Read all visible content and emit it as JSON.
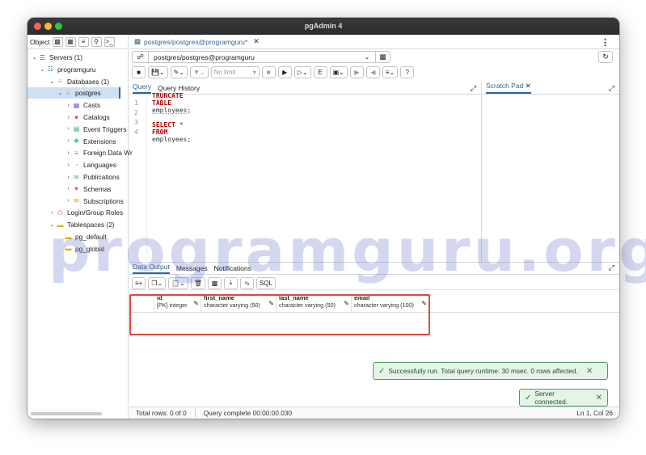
{
  "window": {
    "title": "pgAdmin 4"
  },
  "object_explorer": {
    "label": "Object",
    "tree": [
      {
        "label": "Servers (1)",
        "chev": "v",
        "icon": "server-group-icon",
        "color": "#5b6b7b"
      },
      {
        "label": "programguru",
        "chev": "v",
        "icon": "server-icon",
        "color": "#326690"
      },
      {
        "label": "Databases (1)",
        "chev": "v",
        "icon": "databases-icon",
        "color": "#d4a017"
      },
      {
        "label": "postgres",
        "chev": "v",
        "icon": "database-icon",
        "color": "#d4a017"
      },
      {
        "label": "Casts",
        "chev": ">",
        "icon": "casts-icon",
        "color": "#7a5bc7"
      },
      {
        "label": "Catalogs",
        "chev": ">",
        "icon": "catalogs-icon",
        "color": "#c44"
      },
      {
        "label": "Event Triggers",
        "chev": ">",
        "icon": "event-triggers-icon",
        "color": "#2a8"
      },
      {
        "label": "Extensions",
        "chev": ">",
        "icon": "extensions-icon",
        "color": "#2a7"
      },
      {
        "label": "Foreign Data Wr",
        "chev": ">",
        "icon": "foreign-data-icon",
        "color": "#a73"
      },
      {
        "label": "Languages",
        "chev": ">",
        "icon": "languages-icon",
        "color": "#e9b000"
      },
      {
        "label": "Publications",
        "chev": ">",
        "icon": "publications-icon",
        "color": "#5a7"
      },
      {
        "label": "Schemas",
        "chev": ">",
        "icon": "schemas-icon",
        "color": "#c55"
      },
      {
        "label": "Subscriptions",
        "chev": ">",
        "icon": "subscriptions-icon",
        "color": "#e9a000"
      },
      {
        "label": "Login/Group Roles",
        "chev": ">",
        "icon": "roles-icon",
        "color": "#c44"
      },
      {
        "label": "Tablespaces (2)",
        "chev": "v",
        "icon": "tablespaces-icon",
        "color": "#e9b000"
      },
      {
        "label": "pg_default",
        "chev": "",
        "icon": "folder-icon",
        "color": "#e9b000"
      },
      {
        "label": "pg_global",
        "chev": "",
        "icon": "folder-icon",
        "color": "#e9b000"
      }
    ]
  },
  "tab": {
    "label": "postgres/postgres@programguru*"
  },
  "connection": {
    "value": "postgres/postgres@programguru"
  },
  "toolbar": {
    "limit": "No limit",
    "sql_label": "SQL"
  },
  "editor": {
    "tabs": [
      "Query",
      "Query History"
    ],
    "lines": [
      {
        "n": "1",
        "kw1": "TRUNCATE TABLE",
        "rest": "employees;"
      },
      {
        "n": "2",
        "kw1": "",
        "rest": ""
      },
      {
        "n": "3",
        "kw1": "",
        "rest": ""
      },
      {
        "n": "4",
        "kw1": "SELECT",
        "rest": "* FROM employees;"
      }
    ],
    "line4_kw2": "FROM",
    "line4_star": "*",
    "line4_table": "employees;"
  },
  "scratch": {
    "label": "Scratch Pad"
  },
  "output": {
    "tabs": [
      "Data Output",
      "Messages",
      "Notifications"
    ],
    "columns": [
      {
        "name": "id",
        "type": "[PK] integer"
      },
      {
        "name": "first_name",
        "type": "character varying (50)"
      },
      {
        "name": "last_name",
        "type": "character varying (50)"
      },
      {
        "name": "email",
        "type": "character varying (100)"
      }
    ]
  },
  "toasts": {
    "success": "Successfully run. Total query runtime: 30 msec. 0 rows affected.",
    "connected": "Server connected."
  },
  "status": {
    "rows": "Total rows: 0 of 0",
    "query": "Query complete 00:00:00.030",
    "cursor": "Ln 1, Col 26"
  },
  "watermark": "programguru.org"
}
